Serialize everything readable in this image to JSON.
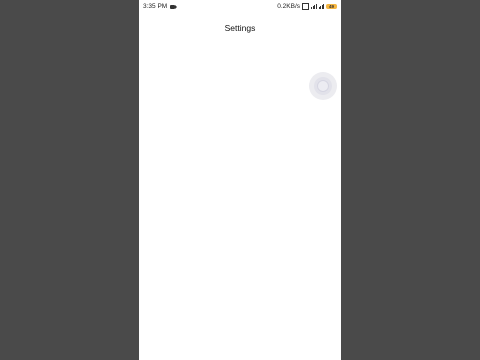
{
  "status_bar": {
    "time": "3:35 PM",
    "network_speed": "0.2KB/s",
    "battery": "49"
  },
  "screen": {
    "title": "Settings"
  },
  "colors": {
    "background": "#4a4a4a",
    "screen": "#ffffff",
    "battery": "#f5b641"
  }
}
